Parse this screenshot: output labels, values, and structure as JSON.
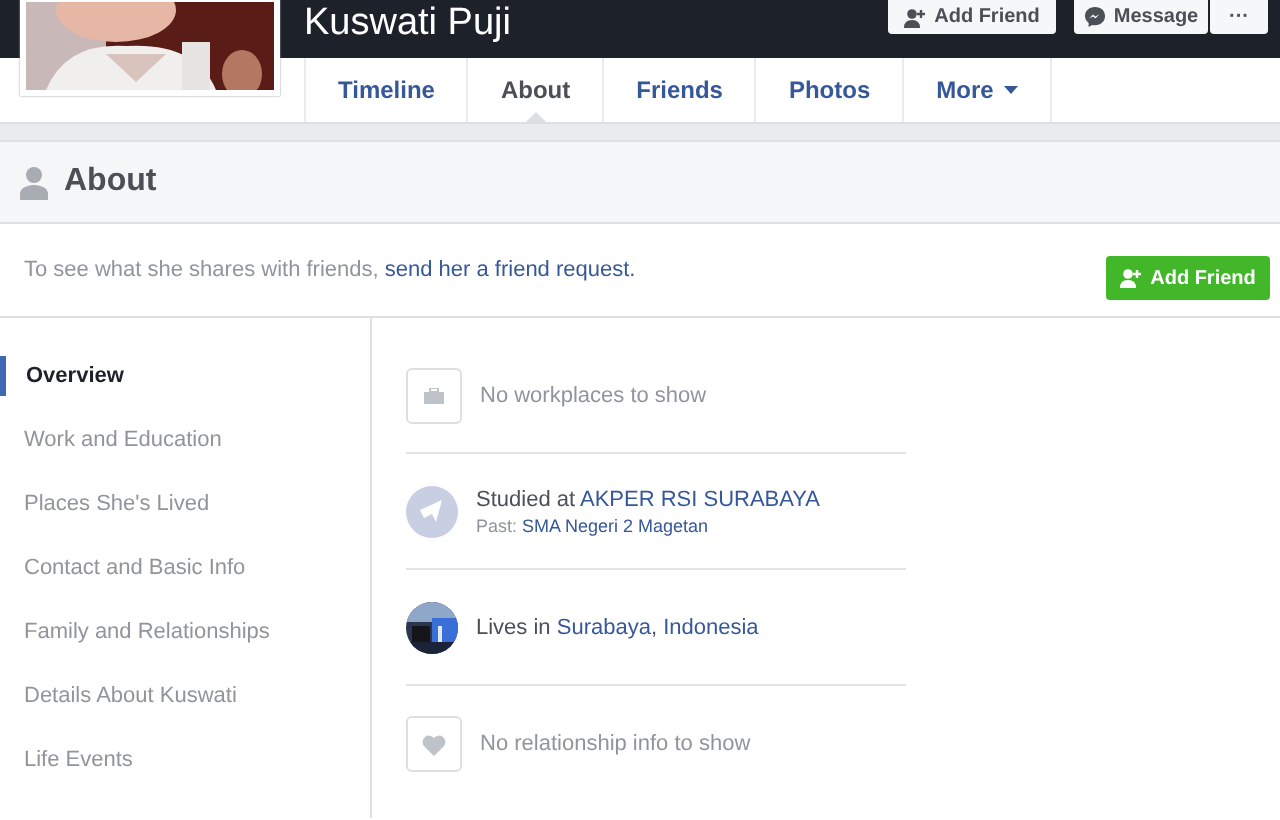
{
  "profile": {
    "name": "Kuswati Puji",
    "actions": [
      {
        "kind": "add",
        "label": "Add Friend"
      },
      {
        "kind": "message",
        "label": "Message"
      },
      {
        "kind": "more",
        "label": "···"
      }
    ]
  },
  "tabs": [
    {
      "label": "Timeline",
      "selected": false
    },
    {
      "label": "About",
      "selected": true
    },
    {
      "label": "Friends",
      "selected": false
    },
    {
      "label": "Photos",
      "selected": false
    },
    {
      "label": "More",
      "selected": false,
      "dropdown": true
    }
  ],
  "about_header": {
    "title": "About"
  },
  "friend_notice": {
    "parts": [
      {
        "text": "To see what she shares with friends, "
      },
      {
        "text": "send her a friend request.",
        "link": true
      }
    ],
    "button": "Add Friend"
  },
  "sidebar": {
    "items": [
      {
        "label": "Overview",
        "selected": true
      },
      {
        "label": "Work and Education",
        "selected": false
      },
      {
        "label": "Places She's Lived",
        "selected": false
      },
      {
        "label": "Contact and Basic Info",
        "selected": false
      },
      {
        "label": "Family and Relationships",
        "selected": false
      },
      {
        "label": "Details About Kuswati",
        "selected": false
      },
      {
        "label": "Life Events",
        "selected": false
      }
    ]
  },
  "overview": [
    {
      "kind": "work",
      "parts": [
        {
          "text": "No workplaces to show"
        }
      ]
    },
    {
      "kind": "education",
      "parts": [
        {
          "text": "Studied at "
        },
        {
          "text": "AKPER RSI SURABAYA",
          "link": true
        }
      ],
      "sub_parts": [
        {
          "text": "Past: "
        },
        {
          "text": "SMA Negeri 2 Magetan",
          "link": true
        }
      ]
    },
    {
      "kind": "place",
      "parts": [
        {
          "text": "Lives in "
        },
        {
          "text": "Surabaya",
          "link": true
        },
        {
          "text": ", "
        },
        {
          "text": "Indonesia",
          "link": true
        }
      ]
    },
    {
      "kind": "relationship",
      "parts": [
        {
          "text": "No relationship info to show"
        }
      ]
    }
  ]
}
